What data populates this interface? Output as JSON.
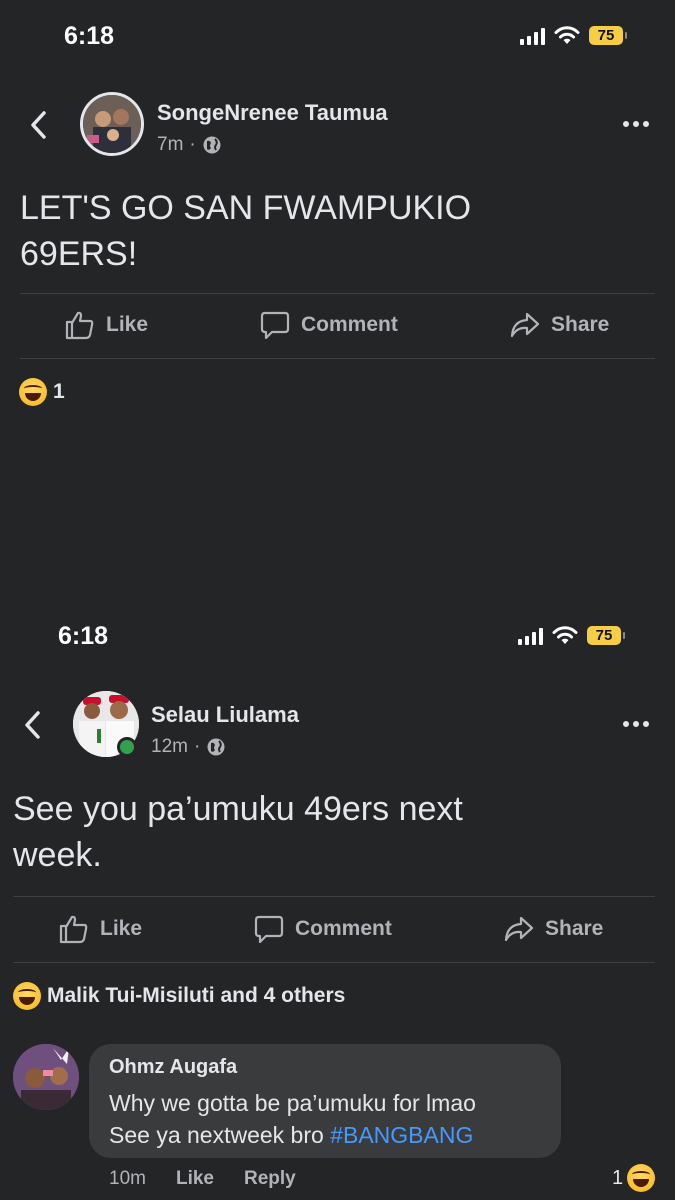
{
  "post1": {
    "status": {
      "time": "6:18",
      "battery": "75"
    },
    "author": "SongeNrenee Taumua",
    "time": "7m",
    "text_line1": "LET'S GO SAN FWAMPUKIO",
    "text_line2": "69ERS!",
    "actions": {
      "like": "Like",
      "comment": "Comment",
      "share": "Share"
    },
    "reactions": {
      "count": "1"
    }
  },
  "post2": {
    "status": {
      "time": "6:18",
      "battery": "75"
    },
    "author": "Selau Liulama",
    "time": "12m",
    "text_line1": "See you pa’umuku 49ers next",
    "text_line2": "week.",
    "actions": {
      "like": "Like",
      "comment": "Comment",
      "share": "Share"
    },
    "reactions": {
      "summary": "Malik Tui-Misiluti and 4 others"
    },
    "comment": {
      "author": "Ohmz Augafa",
      "line1": "Why we gotta be pa’umuku for lmao",
      "line2_text": "See ya nextweek bro ",
      "hashtag": "#BANGBANG",
      "time": "10m",
      "like": "Like",
      "reply": "Reply",
      "reaction_count": "1"
    }
  },
  "icons": [
    "back-chevron-icon",
    "globe-icon",
    "more-icon",
    "like-thumb-icon",
    "comment-icon",
    "share-arrow-icon",
    "haha-reaction-icon",
    "signal-icon",
    "wifi-icon",
    "battery-icon"
  ],
  "colors": {
    "background": "#242526",
    "text": "#e4e6eb",
    "secondary": "#b0b3b8",
    "hashtag": "#4599ff",
    "battery": "#f7cd46",
    "online": "#31a24c"
  }
}
